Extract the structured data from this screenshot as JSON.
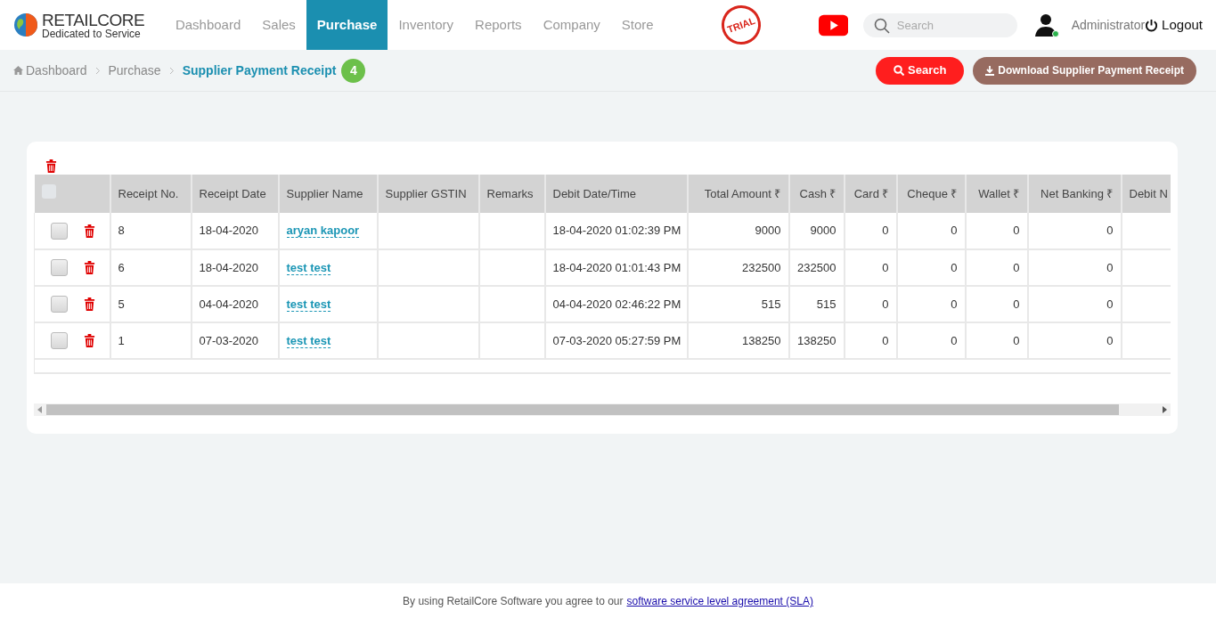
{
  "brand": {
    "name": "RETAILCORE",
    "tagline": "Dedicated to Service"
  },
  "nav": [
    {
      "label": "Dashboard",
      "selected": false
    },
    {
      "label": "Sales",
      "selected": false
    },
    {
      "label": "Purchase",
      "selected": true
    },
    {
      "label": "Inventory",
      "selected": false
    },
    {
      "label": "Reports",
      "selected": false
    },
    {
      "label": "Company",
      "selected": false
    },
    {
      "label": "Store",
      "selected": false
    }
  ],
  "trial_stamp": "TRIAL",
  "search": {
    "placeholder": "Search"
  },
  "user": {
    "name": "Administrator",
    "online": true
  },
  "logout": "Logout",
  "breadcrumb": [
    {
      "label": "Dashboard",
      "current": false
    },
    {
      "label": "Purchase",
      "current": false
    },
    {
      "label": "Supplier Payment Receipt",
      "current": true
    }
  ],
  "count_badge": "4",
  "actions": {
    "search": "Search",
    "download": "Download Supplier Payment Receipt"
  },
  "table": {
    "select_all_checked": false,
    "columns": [
      {
        "label": "Receipt No.",
        "kind": "text"
      },
      {
        "label": "Receipt Date",
        "kind": "text"
      },
      {
        "label": "Supplier Name",
        "kind": "link"
      },
      {
        "label": "Supplier GSTIN",
        "kind": "text"
      },
      {
        "label": "Remarks",
        "kind": "text"
      },
      {
        "label": "Debit Date/Time",
        "kind": "text"
      },
      {
        "label": "Total Amount ₹",
        "kind": "amount"
      },
      {
        "label": "Cash ₹",
        "kind": "amount"
      },
      {
        "label": "Card ₹",
        "kind": "amount"
      },
      {
        "label": "Cheque ₹",
        "kind": "amount"
      },
      {
        "label": "Wallet ₹",
        "kind": "amount"
      },
      {
        "label": "Net Banking ₹",
        "kind": "amount"
      },
      {
        "label": "Debit N",
        "kind": "text"
      }
    ],
    "rows": [
      {
        "checked": false,
        "cells": [
          "8",
          "18-04-2020",
          "aryan kapoor",
          "",
          "",
          "18-04-2020 01:02:39 PM",
          "9000",
          "9000",
          "0",
          "0",
          "0",
          "0",
          ""
        ]
      },
      {
        "checked": false,
        "cells": [
          "6",
          "18-04-2020",
          "test test",
          "",
          "",
          "18-04-2020 01:01:43 PM",
          "232500",
          "232500",
          "0",
          "0",
          "0",
          "0",
          ""
        ]
      },
      {
        "checked": false,
        "cells": [
          "5",
          "04-04-2020",
          "test test",
          "",
          "",
          "04-04-2020 02:46:22 PM",
          "515",
          "515",
          "0",
          "0",
          "0",
          "0",
          ""
        ]
      },
      {
        "checked": false,
        "cells": [
          "1",
          "07-03-2020",
          "test test",
          "",
          "",
          "07-03-2020 05:27:59 PM",
          "138250",
          "138250",
          "0",
          "0",
          "0",
          "0",
          ""
        ]
      }
    ]
  },
  "footer": {
    "text": "By using RetailCore Software you agree to our",
    "link": "software service level agreement (SLA)"
  }
}
